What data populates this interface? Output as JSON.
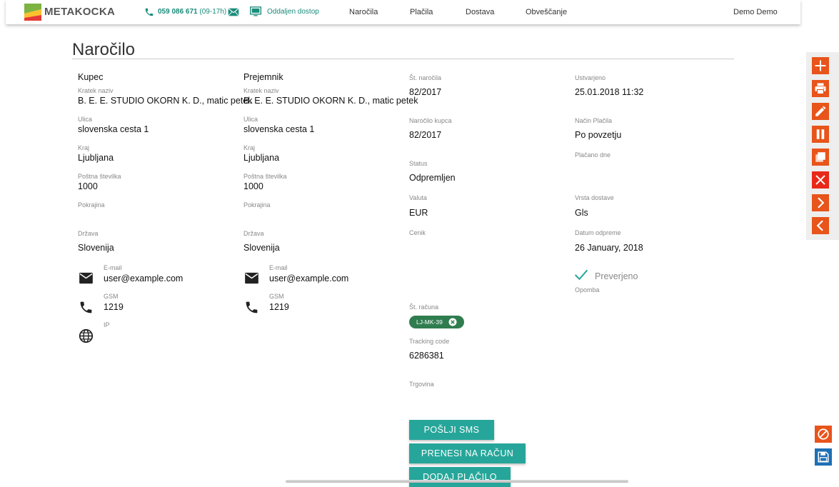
{
  "header": {
    "logo_text": "METAKOCKA",
    "phone": "059 086 671",
    "phone_hours": "(09-17h)",
    "remote_access": "Oddaljen dostop",
    "nav": [
      "Naročila",
      "Plačila",
      "Dostava",
      "Obveščanje"
    ],
    "user": "Demo Demo"
  },
  "page": {
    "title": "Naročilo"
  },
  "buyer": {
    "header": "Kupec",
    "short_name_label": "Kratek naziv",
    "short_name": "B. E. E. STUDIO OKORN K. D., matic petek",
    "street_label": "Ulica",
    "street": "slovenska cesta 1",
    "city_label": "Kraj",
    "city": "Ljubljana",
    "postal_label": "Poštna številka",
    "postal": "1000",
    "region_label": "Pokrajina",
    "country_label": "Država",
    "country": "Slovenija",
    "email_label": "E-mail",
    "email": "user@example.com",
    "gsm_label": "GSM",
    "gsm": "1219",
    "ip_label": "IP"
  },
  "receiver": {
    "header": "Prejemnik",
    "short_name_label": "Kratek naziv",
    "short_name": "B. E. E. STUDIO OKORN K. D., matic petek",
    "street_label": "Ulica",
    "street": "slovenska cesta 1",
    "city_label": "Kraj",
    "city": "Ljubljana",
    "postal_label": "Poštna številka",
    "postal": "1000",
    "region_label": "Pokrajina",
    "country_label": "Država",
    "country": "Slovenija",
    "email_label": "E-mail",
    "email": "user@example.com",
    "gsm_label": "GSM",
    "gsm": "1219"
  },
  "order": {
    "number_label": "Št. naročila",
    "number": "82/2017",
    "customer_order_label": "Naročilo kupca",
    "customer_order": "82/2017",
    "status_label": "Status",
    "status": "Odpremljen",
    "currency_label": "Valuta",
    "currency": "EUR",
    "pricelist_label": "Cenik",
    "invoice_label": "Št. računa",
    "invoice_chip": "LJ-MK-39",
    "tracking_label": "Tracking code",
    "tracking": "6286381",
    "store_label": "Trgovina"
  },
  "meta": {
    "created_label": "Ustvarjeno",
    "created": "25.01.2018 11:32",
    "payment_method_label": "Način Plačila",
    "payment_method": "Po povzetju",
    "paid_on_label": "Plačano dne",
    "delivery_type_label": "Vrsta dostave",
    "delivery_type": "Gls",
    "dispatch_date_label": "Datum odpreme",
    "dispatch_date": "26 January, 2018",
    "verified_label": "Preverjeno",
    "note_label": "Opomba"
  },
  "actions": {
    "send_sms": "POŠLJI SMS",
    "transfer_invoice": "PRENESI NA RAČUN",
    "add_payment": "DODAJ PLAČILO"
  },
  "colors": {
    "accent_green": "#26a69a",
    "link_teal": "#1a8c7a",
    "orange": "#e8541a",
    "red": "#e8291a",
    "save_blue": "#1f6fb4",
    "chip_green": "#2f7d4f"
  }
}
